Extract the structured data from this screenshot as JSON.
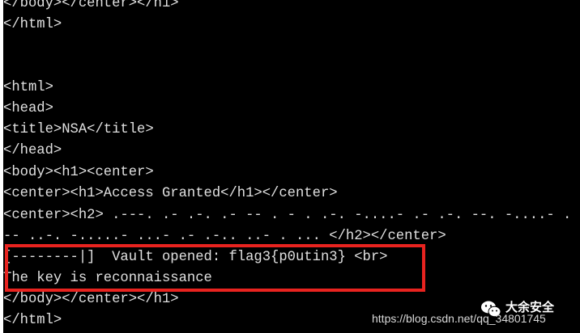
{
  "terminal": {
    "lines": [
      "</body></center></h1>",
      "</html>",
      "",
      "",
      "<html>",
      "<head>",
      "<title>NSA</title>",
      "</head>",
      "<body><h1><center>",
      "<center><h1>Access Granted</h1></center>",
      "<center><h2> .---. .- .-. .- -- . - . .-. -....- .- .-. --. -....- .",
      "-- ..-. -.....- ...- .- .-.. ..- . ... </h2></center>",
      "[--------|]  Vault opened: flag3{p0utin3} <br>",
      "The key is reconnaissance",
      "</body></center></h1>",
      "</html>"
    ]
  },
  "watermark": {
    "url": "https://blog.csdn.net/qq_34801745",
    "account_name": "大余安全",
    "logo_icon": "wechat-icon"
  },
  "colors": {
    "terminal_bg": "#000000",
    "terminal_text": "#e0e0e0",
    "highlight_border": "#e8231f"
  }
}
